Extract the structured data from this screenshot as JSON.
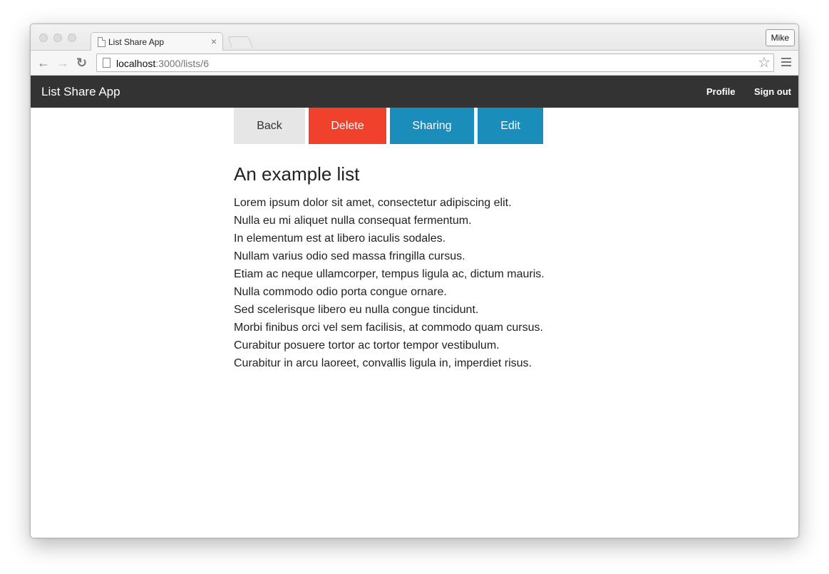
{
  "browser": {
    "tab_title": "List Share App",
    "tab_close": "×",
    "profile_name": "Mike",
    "url_host": "localhost",
    "url_path": ":3000/lists/6",
    "icons": [
      "back-arrow-icon",
      "forward-arrow-icon",
      "reload-icon",
      "page-icon",
      "star-icon",
      "menu-icon",
      "close-icon"
    ]
  },
  "navbar": {
    "brand": "List Share App",
    "profile_link": "Profile",
    "signout_link": "Sign out",
    "background": "#333333"
  },
  "actions": {
    "back": "Back",
    "delete": "Delete",
    "sharing": "Sharing",
    "edit": "Edit",
    "colors": {
      "back": "#e6e6e6",
      "delete": "#f0412d",
      "sharing": "#1b8dbb",
      "edit": "#1b8dbb"
    }
  },
  "list": {
    "title": "An example list",
    "items": [
      "Lorem ipsum dolor sit amet, consectetur adipiscing elit.",
      "Nulla eu mi aliquet nulla consequat fermentum.",
      "In elementum est at libero iaculis sodales.",
      "Nullam varius odio sed massa fringilla cursus.",
      "Etiam ac neque ullamcorper, tempus ligula ac, dictum mauris.",
      "Nulla commodo odio porta congue ornare.",
      "Sed scelerisque libero eu nulla congue tincidunt.",
      "Morbi finibus orci vel sem facilisis, at commodo quam cursus.",
      "Curabitur posuere tortor ac tortor tempor vestibulum.",
      "Curabitur in arcu laoreet, convallis ligula in, imperdiet risus."
    ]
  }
}
